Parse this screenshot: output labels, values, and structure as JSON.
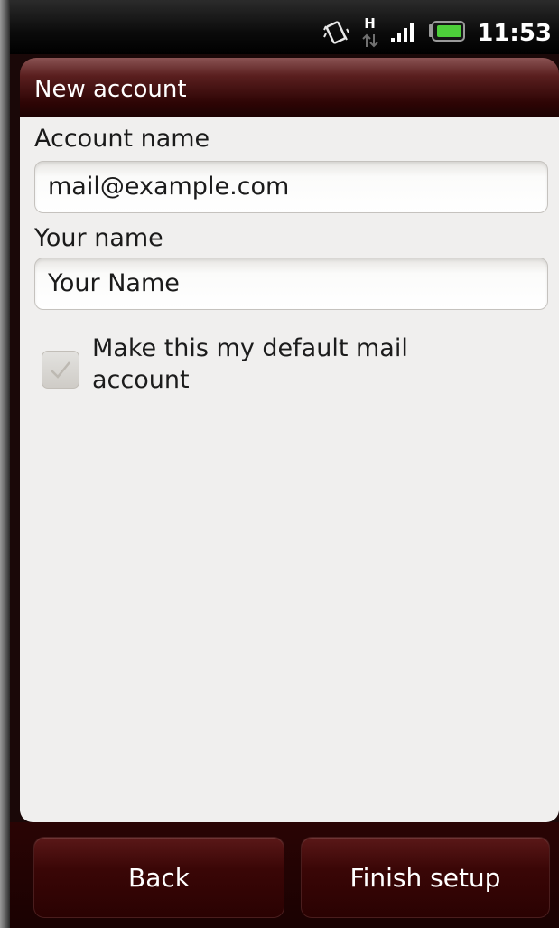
{
  "status_bar": {
    "time": "11:53",
    "network_type": "H",
    "icons": [
      "vibrate-icon",
      "network-activity-icon",
      "signal-icon",
      "battery-icon"
    ]
  },
  "title_bar": {
    "title": "New account"
  },
  "form": {
    "account_name_label": "Account name",
    "account_name_value": "mail@example.com",
    "your_name_label": "Your name",
    "your_name_value": "Your Name",
    "default_account_label": "Make this my default mail account",
    "default_account_checked": true
  },
  "buttons": {
    "back_label": "Back",
    "finish_label": "Finish setup"
  },
  "colors": {
    "title_bar_dark": "#2e0505",
    "content_bg": "#f0efee",
    "button_bg": "#3a0606",
    "battery_green": "#4dcf3a"
  }
}
